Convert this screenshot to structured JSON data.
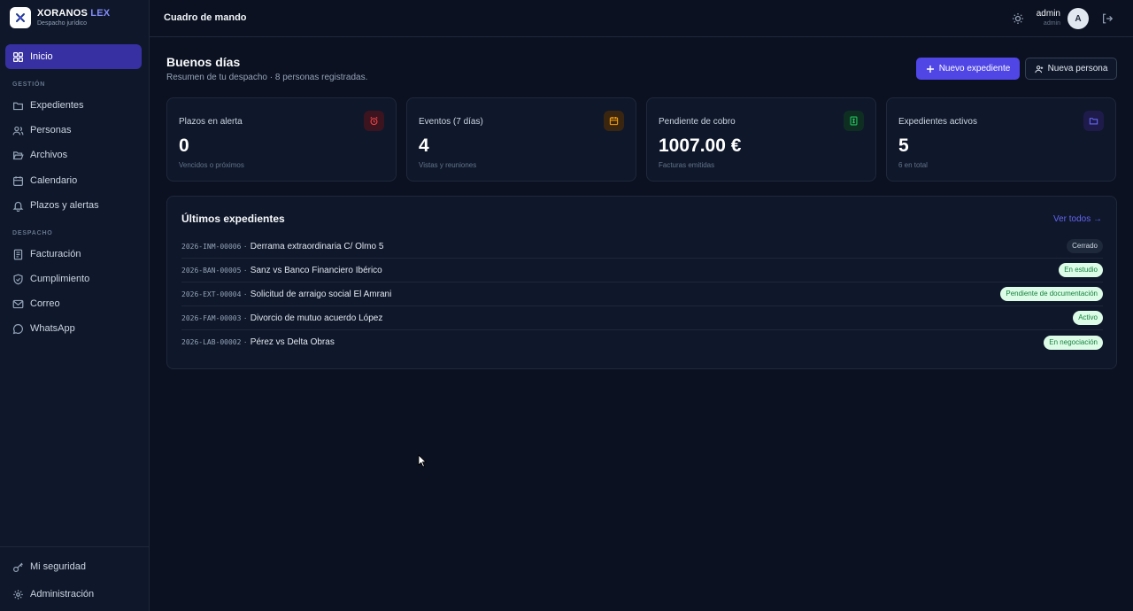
{
  "brand": {
    "name_main": "XORANOS",
    "name_accent": "LEX",
    "subtitle": "Despacho jurídico"
  },
  "sidebar": {
    "items_top": [
      {
        "label": "Inicio",
        "icon": "grid-icon",
        "active": true
      }
    ],
    "sections": [
      {
        "label": "GESTIÓN",
        "items": [
          {
            "label": "Expedientes",
            "icon": "folder-icon"
          },
          {
            "label": "Personas",
            "icon": "users-icon"
          },
          {
            "label": "Archivos",
            "icon": "folder-open-icon"
          },
          {
            "label": "Calendario",
            "icon": "calendar-icon"
          },
          {
            "label": "Plazos y alertas",
            "icon": "bell-icon"
          }
        ]
      },
      {
        "label": "DESPACHO",
        "items": [
          {
            "label": "Facturación",
            "icon": "invoice-icon"
          },
          {
            "label": "Cumplimiento",
            "icon": "shield-icon"
          },
          {
            "label": "Correo",
            "icon": "mail-icon"
          },
          {
            "label": "WhatsApp",
            "icon": "chat-icon"
          }
        ]
      }
    ],
    "bottom": [
      {
        "label": "Mi seguridad",
        "icon": "key-icon"
      },
      {
        "label": "Administración",
        "icon": "gear-icon"
      }
    ]
  },
  "topbar": {
    "title": "Cuadro de mando",
    "user_name": "admin",
    "user_role": "admin",
    "avatar_initial": "A"
  },
  "main": {
    "greeting": "Buenos días",
    "subtitle": "Resumen de tu despacho · 8 personas registradas.",
    "primary_button": "Nuevo expediente",
    "secondary_button": "Nueva persona",
    "stats": [
      {
        "label": "Plazos en alerta",
        "value": "0",
        "sub": "Vencidos o próximos",
        "icon": "alarm-icon",
        "color": "#ef4444"
      },
      {
        "label": "Eventos (7 días)",
        "value": "4",
        "sub": "Vistas y reuniones",
        "icon": "calendar-icon",
        "color": "#f59e0b"
      },
      {
        "label": "Pendiente de cobro",
        "value": "1007.00 €",
        "sub": "Facturas emitidas",
        "icon": "invoice-icon",
        "color": "#22c55e"
      },
      {
        "label": "Expedientes activos",
        "value": "5",
        "sub": "6 en total",
        "icon": "folder-icon",
        "color": "#6366f1"
      }
    ],
    "recent": {
      "title": "Últimos expedientes",
      "link": "Ver todos →",
      "rows": [
        {
          "code": "2026-INM-00006",
          "title": "Derrama extraordinaria C/ Olmo 5",
          "status": "Cerrado",
          "status_style": "neutral"
        },
        {
          "code": "2026-BAN-00005",
          "title": "Sanz vs Banco Financiero Ibérico",
          "status": "En estudio",
          "status_style": "green"
        },
        {
          "code": "2026-EXT-00004",
          "title": "Solicitud de arraigo social El Amrani",
          "status": "Pendiente de documentación",
          "status_style": "green"
        },
        {
          "code": "2026-FAM-00003",
          "title": "Divorcio de mutuo acuerdo López",
          "status": "Activo",
          "status_style": "green"
        },
        {
          "code": "2026-LAB-00002",
          "title": "Pérez vs Delta Obras",
          "status": "En negociación",
          "status_style": "green"
        }
      ]
    }
  }
}
